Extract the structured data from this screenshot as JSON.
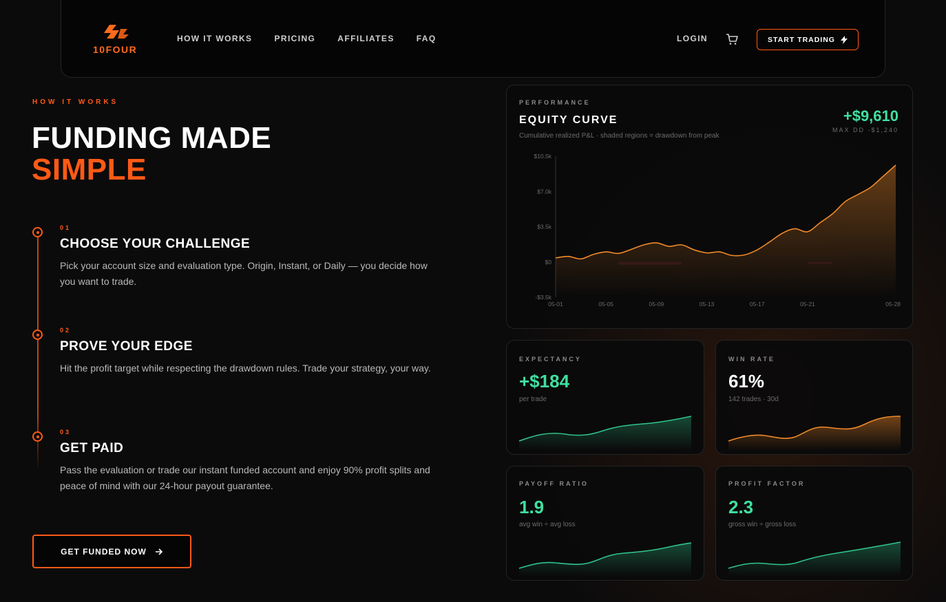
{
  "nav": {
    "logo_text": "10FOUR",
    "links": [
      "HOW IT WORKS",
      "PRICING",
      "AFFILIATES",
      "FAQ"
    ],
    "login": "LOGIN",
    "start_label": "START TRADING"
  },
  "hero": {
    "eyebrow": "HOW IT WORKS",
    "title_line1": "FUNDING MADE",
    "title_line2": "SIMPLE"
  },
  "steps": [
    {
      "num": "01",
      "title": "CHOOSE YOUR CHALLENGE",
      "desc": "Pick your account size and evaluation type. Origin, Instant, or Daily — you decide how you want to trade."
    },
    {
      "num": "02",
      "title": "PROVE YOUR EDGE",
      "desc": "Hit the profit target while respecting the drawdown rules. Trade your strategy, your way."
    },
    {
      "num": "03",
      "title": "GET PAID",
      "desc": "Pass the evaluation or trade our instant funded account and enjoy 90% profit splits and peace of mind with our 24-hour payout guarantee."
    }
  ],
  "cta": {
    "label": "GET FUNDED NOW"
  },
  "equity": {
    "label": "PERFORMANCE",
    "title": "EQUITY CURVE",
    "total": "+$9,610",
    "max_dd": "MAX DD -$1,240",
    "desc": "Cumulative realized P&L · shaded regions = drawdown from peak"
  },
  "stats": [
    {
      "label": "EXPECTANCY",
      "value": "+$184",
      "sub": "per trade"
    },
    {
      "label": "WIN RATE",
      "value": "61%",
      "sub": "142 trades · 30d"
    },
    {
      "label": "PAYOFF RATIO",
      "value": "1.9",
      "sub": "avg win ÷ avg loss"
    },
    {
      "label": "PROFIT FACTOR",
      "value": "2.3",
      "sub": "gross win ÷ gross loss"
    }
  ],
  "colors": {
    "accent": "#ff5a16",
    "green": "#3fe0a0",
    "orange_line": "#f08a2a"
  },
  "chart_data": {
    "type": "area",
    "ylim": [
      -3500,
      10500
    ],
    "y_ticks": [
      "$10.5k",
      "$7.0k",
      "$3.5k",
      "$0",
      "-$3.5k"
    ],
    "x_ticks": [
      "05-01",
      "05-05",
      "05-09",
      "05-13",
      "05-17",
      "05-21",
      "05-28"
    ],
    "x": [
      0,
      1,
      2,
      3,
      4,
      5,
      6,
      7,
      8,
      9,
      10,
      11,
      12,
      13,
      14,
      15,
      16,
      17,
      18,
      19,
      20,
      21,
      22,
      23,
      24,
      25,
      26,
      27
    ],
    "values": [
      400,
      550,
      300,
      750,
      1000,
      850,
      1250,
      1700,
      1900,
      1550,
      1700,
      1200,
      900,
      1000,
      650,
      700,
      1200,
      2000,
      2850,
      3300,
      3000,
      3900,
      4800,
      6000,
      6700,
      7400,
      8500,
      9610
    ],
    "grid": false
  }
}
